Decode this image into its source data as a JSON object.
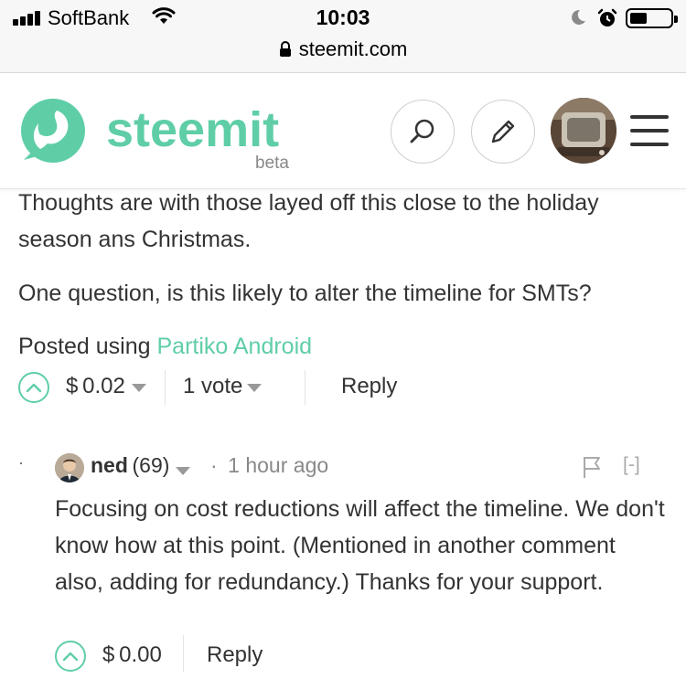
{
  "status_bar": {
    "carrier": "SoftBank",
    "time": "10:03",
    "url": "steemit.com"
  },
  "header": {
    "brand": "steemit",
    "badge": "beta",
    "brand_color": "#5fcea7",
    "icons": [
      "steemit-logo",
      "search-icon",
      "pencil-icon",
      "user-avatar",
      "hamburger-menu-icon"
    ]
  },
  "comment": {
    "paragraphs": [
      "Thoughts are with those layed off this close to the holiday season ans Christmas.",
      "One question, is this likely to alter the timeline for SMTs?"
    ],
    "posted_prefix": "Posted using ",
    "posted_link": "Partiko Android",
    "payout": "$ 0.02",
    "votes": "1 vote",
    "reply": "Reply"
  },
  "reply": {
    "bullet": "·",
    "author": "ned",
    "reputation": "(69)",
    "separator": "·",
    "time_ago": "1 hour ago",
    "collapse": "[-]",
    "body": "Focusing on cost reductions will affect the timeline. We don't know how at this point. (Mentioned in another comment also, adding for redundancy.) Thanks for your support.",
    "payout": "$ 0.00",
    "reply": "Reply"
  }
}
